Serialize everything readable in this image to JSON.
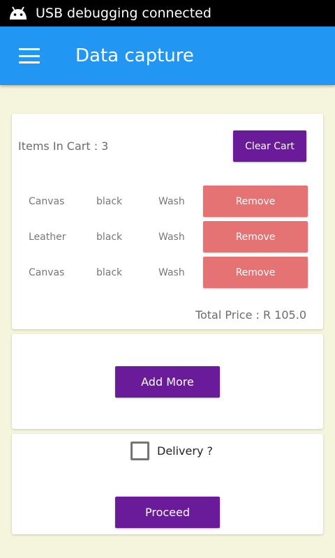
{
  "status_bar": {
    "icon": "android-icon",
    "text": "USB debugging connected"
  },
  "app_bar": {
    "menu_icon": "menu-icon",
    "title": "Data capture"
  },
  "cart": {
    "items_label": "Items In Cart : 3",
    "clear_label": "Clear Cart",
    "items": [
      {
        "material": "Canvas",
        "color": "black",
        "wash": "Wash",
        "remove_label": "Remove"
      },
      {
        "material": "Leather",
        "color": "black",
        "wash": "Wash",
        "remove_label": "Remove"
      },
      {
        "material": "Canvas",
        "color": "black",
        "wash": "Wash",
        "remove_label": "Remove"
      }
    ],
    "total_price": "Total Price : R 105.0"
  },
  "add_more": {
    "label": "Add More"
  },
  "checkout": {
    "delivery_label": "Delivery ?",
    "delivery_checked": false,
    "proceed_label": "Proceed"
  },
  "colors": {
    "app_bar": "#2196f3",
    "primary_button": "#6a1b9a",
    "remove_button": "#e57373",
    "background": "#f5f4dc"
  }
}
